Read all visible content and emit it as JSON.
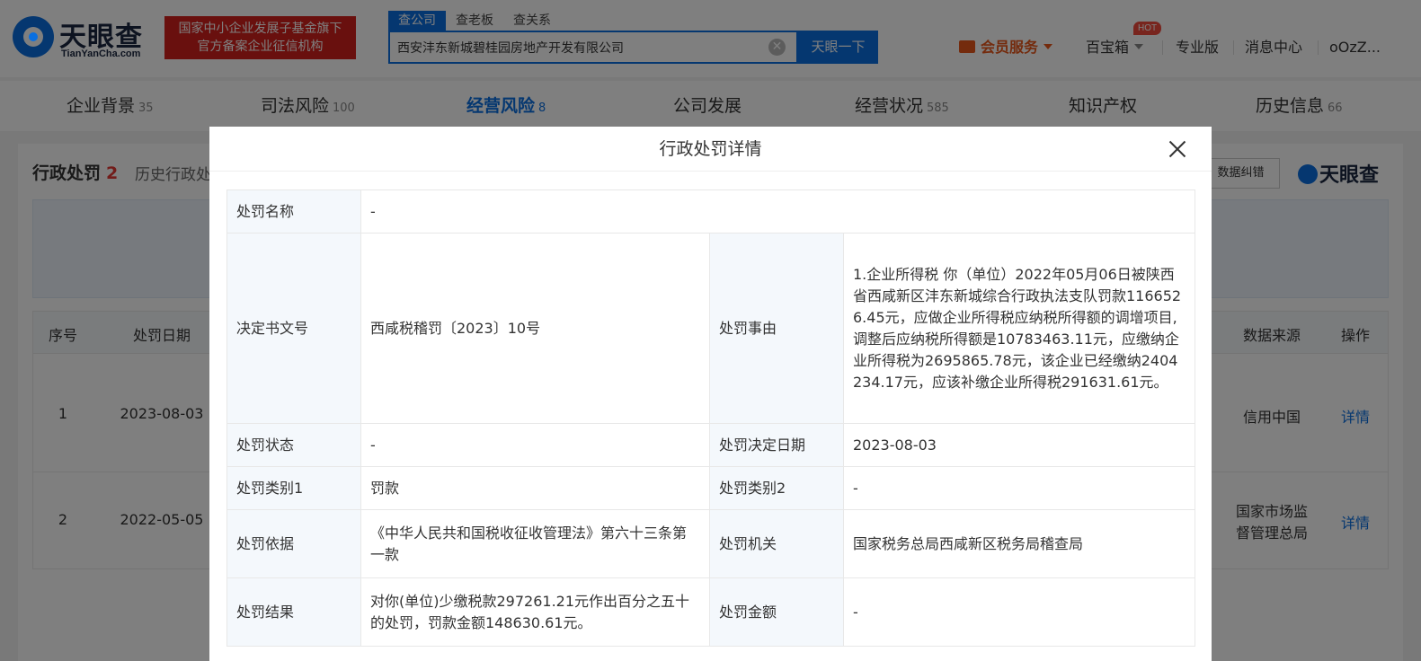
{
  "header": {
    "logo_cn": "天眼查",
    "logo_en": "TianYanCha.com",
    "gov_badge_line1": "国家中小企业发展子基金旗下",
    "gov_badge_line2": "官方备案企业征信机构",
    "search_tabs": [
      "查公司",
      "查老板",
      "查关系"
    ],
    "search_value": "西安沣东新城碧桂园房地产开发有限公司",
    "clear_symbol": "✕",
    "search_button": "天眼一下",
    "vip_service": "会员服务",
    "toolbox": "百宝箱",
    "hot_badge": "HOT",
    "pro_version": "专业版",
    "message_center": "消息中心",
    "username": "oOzZ..."
  },
  "nav_tabs": [
    {
      "label": "企业背景",
      "count": "35"
    },
    {
      "label": "司法风险",
      "count": "100"
    },
    {
      "label": "经营风险",
      "count": "8"
    },
    {
      "label": "公司发展",
      "count": ""
    },
    {
      "label": "经营状况",
      "count": "585"
    },
    {
      "label": "知识产权",
      "count": ""
    },
    {
      "label": "历史信息",
      "count": "66"
    }
  ],
  "section": {
    "title": "行政处罚",
    "count": "2",
    "history_link": "历史行政处",
    "correction_button": "数据纠错",
    "watermark": "天眼查"
  },
  "list_table": {
    "headers": {
      "index": "序号",
      "date": "处罚日期",
      "source": "数据来源",
      "action": "操作"
    },
    "rows": [
      {
        "index": "1",
        "date": "2023-08-03",
        "source_line1": "信用中国",
        "source_line2": "",
        "action": "详情"
      },
      {
        "index": "2",
        "date": "2022-05-05",
        "source_line1": "国家市场监",
        "source_line2": "督管理总局",
        "action": "详情"
      }
    ]
  },
  "modal": {
    "title": "行政处罚详情",
    "rows": {
      "name_label": "处罚名称",
      "name_value": "-",
      "doc_label": "决定书文号",
      "doc_value": "西咸税稽罚〔2023〕10号",
      "reason_label": "处罚事由",
      "reason_value": "1.企业所得税 你（单位）2022年05月06日被陕西省西咸新区沣东新城综合行政执法支队罚款1166526.45元，应做企业所得税应纳税所得额的调增项目,调整后应纳税所得额是10783463.11元，应缴纳企业所得税为2695865.78元，该企业已经缴纳2404234.17元，应该补缴企业所得税291631.61元。",
      "status_label": "处罚状态",
      "status_value": "-",
      "decision_date_label": "处罚决定日期",
      "decision_date_value": "2023-08-03",
      "category1_label": "处罚类别1",
      "category1_value": "罚款",
      "category2_label": "处罚类别2",
      "category2_value": "-",
      "basis_label": "处罚依据",
      "basis_value": "《中华人民共和国税收征收管理法》第六十三条第一款",
      "authority_label": "处罚机关",
      "authority_value": "国家税务总局西咸新区税务局稽查局",
      "result_label": "处罚结果",
      "result_value": "对你(单位)少缴税款297261.21元作出百分之五十的处罚，罚款金额148630.61元。",
      "amount_label": "处罚金额",
      "amount_value": "-"
    }
  },
  "colors": {
    "brand_blue": "#0a6fe0",
    "badge_red": "#d3211d",
    "vip_orange": "#e8571b",
    "label_bg": "#f4f8fc"
  }
}
